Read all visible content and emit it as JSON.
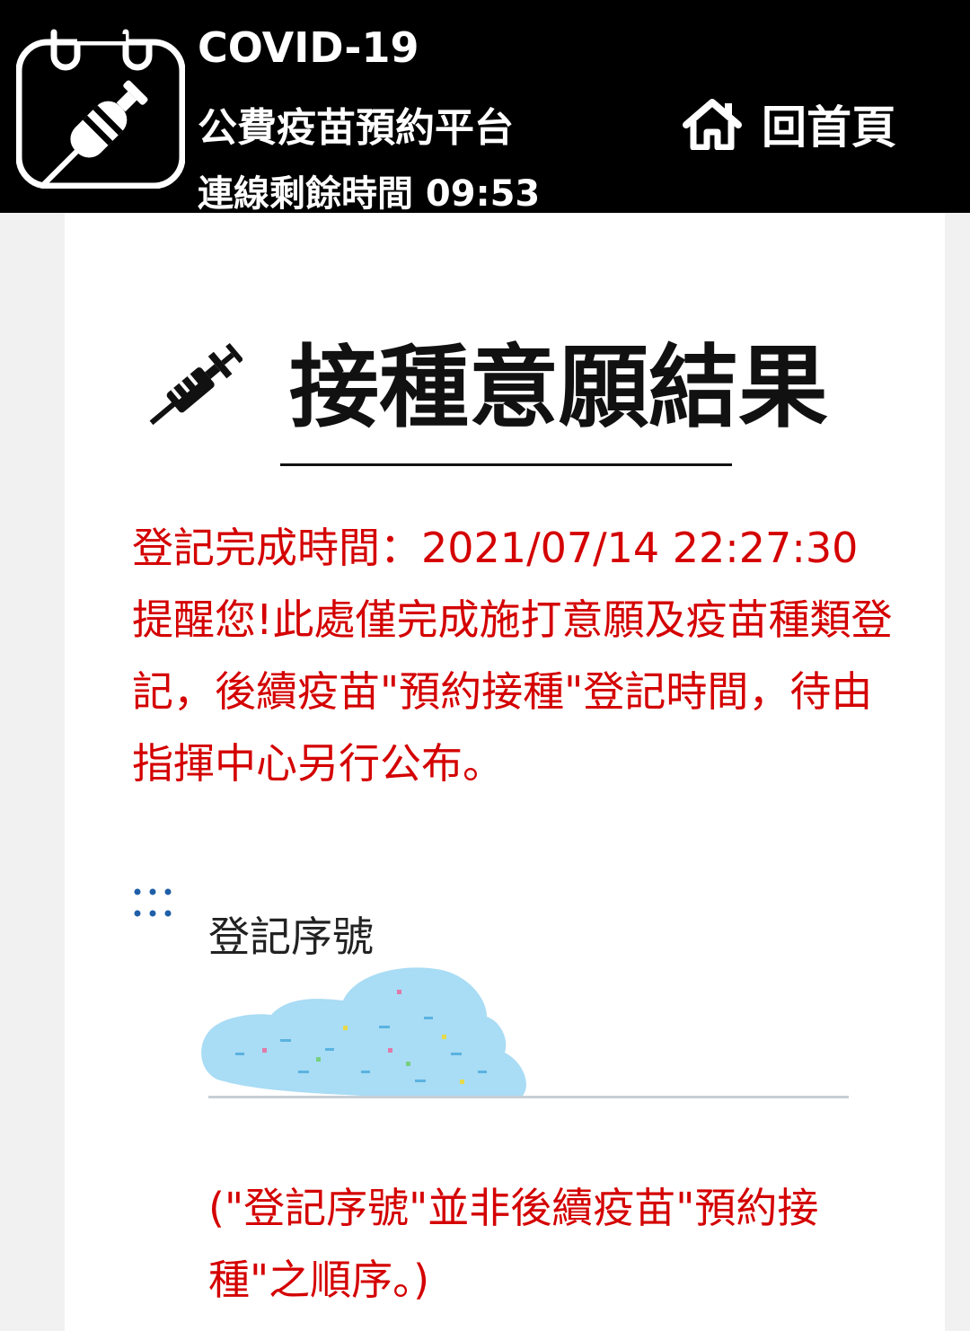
{
  "header": {
    "line1": "COVID-19",
    "line2": "公費疫苗預約平台",
    "line3": "連線剩餘時間 09:53",
    "home_icon": "home-icon",
    "home_label": "回首頁",
    "logo_icon": "vaccine-calendar-icon"
  },
  "main": {
    "title_icon": "syringe-icon",
    "title": "接種意願結果",
    "notice": {
      "completed_time": "登記完成時間：2021/07/14 22:27:30",
      "reminder": "提醒您!此處僅完成施打意願及疫苗種類登記，後續疫苗\"預約接種\"登記時間，待由指揮中心另行公布。"
    },
    "serial": {
      "icon": "dots-icon",
      "label": "登記序號",
      "note": "(\"登記序號\"並非後續疫苗\"預約接種\"之順序。)"
    }
  },
  "colors": {
    "header_bg": "#000000",
    "accent_red": "#d40000",
    "page_bg": "#f1f1f1",
    "card_bg": "#ffffff",
    "dots_blue": "#1f5fa8",
    "redaction_blue": "#a9dcf5"
  }
}
